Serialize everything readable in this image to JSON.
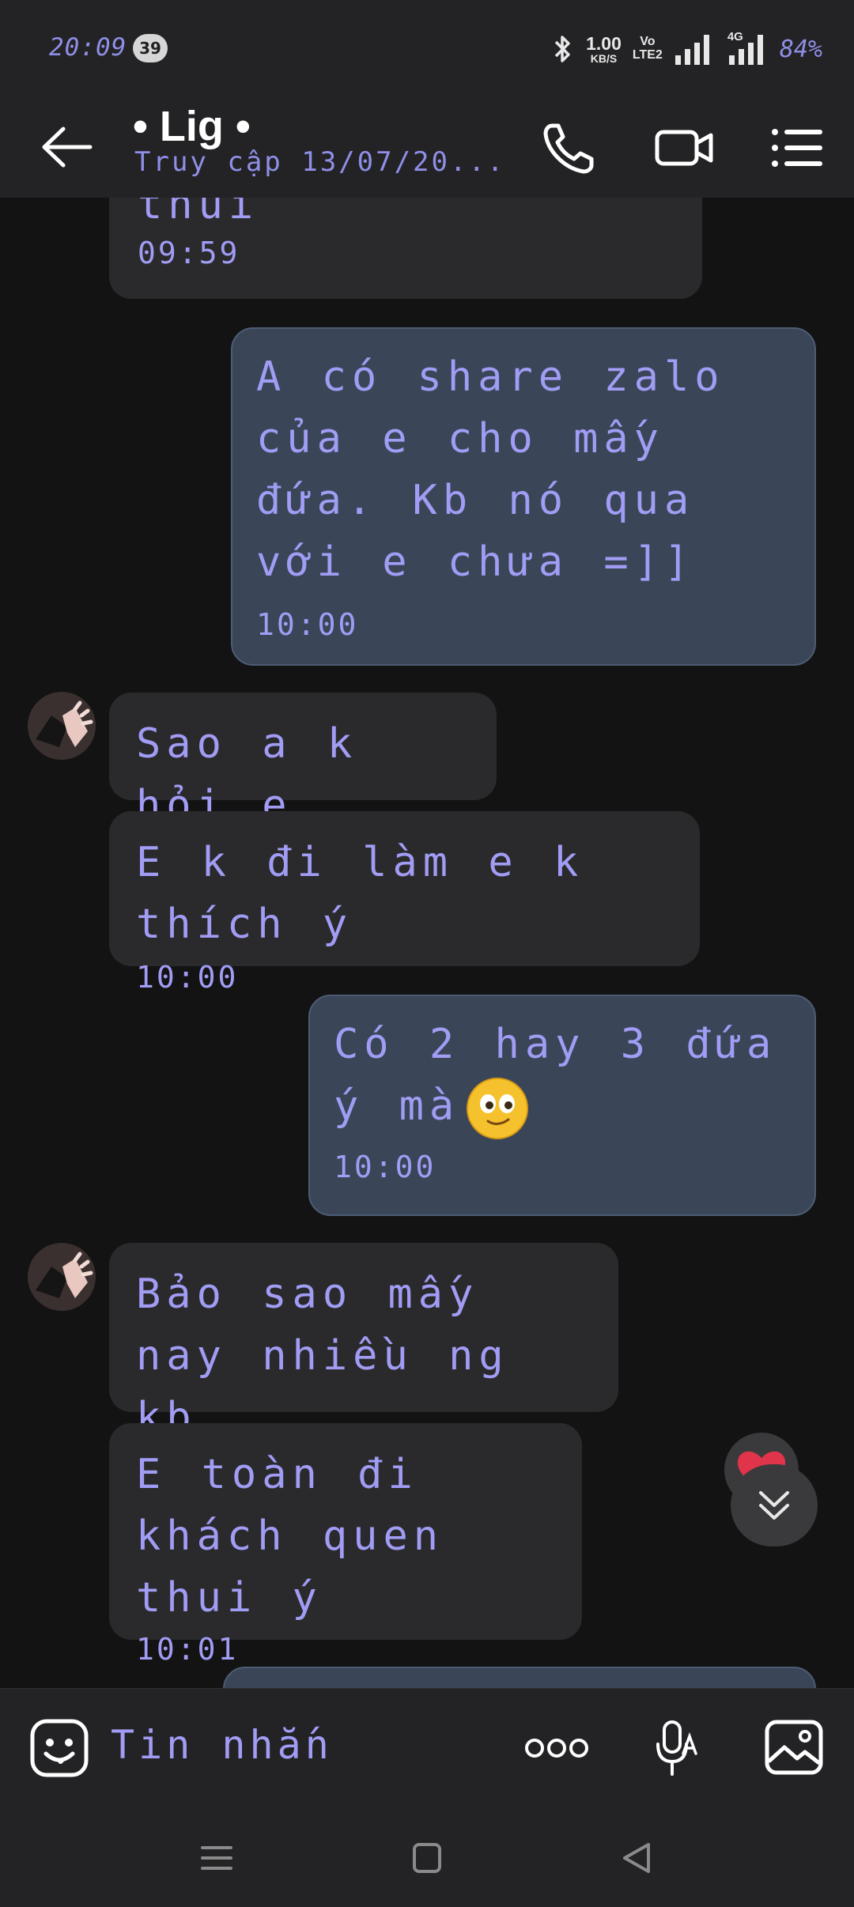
{
  "status_bar": {
    "time": "20:09",
    "notification_count": "39",
    "net_speed_value": "1.00",
    "net_speed_unit": "KB/S",
    "volte_line1": "Vo",
    "volte_line2": "LTE2",
    "network_type": "4G",
    "battery": "84%"
  },
  "header": {
    "title": "• Lig •",
    "subtitle": "Truy cập 13/07/20..."
  },
  "messages": [
    {
      "sender": "contact",
      "text": "thui",
      "time": "09:59"
    },
    {
      "sender": "me",
      "text": "A có share zalo của e cho mấy đứa. Kb nó qua với e chưa =]]",
      "time": "10:00"
    },
    {
      "sender": "contact",
      "text": "Sao a k hỏi e",
      "time": ""
    },
    {
      "sender": "contact",
      "text": "E k đi làm e k thích ý",
      "time": "10:00"
    },
    {
      "sender": "me",
      "text": "Có 2 hay 3 đứa ý mà",
      "emoji": "smiling-face-emoji",
      "time": "10:00"
    },
    {
      "sender": "contact",
      "text": "Bảo sao mấy nay nhiều ng kb",
      "time": ""
    },
    {
      "sender": "contact",
      "text": "E toàn đi khách quen thui ý",
      "time": "10:01",
      "reaction": "heart"
    }
  ],
  "input": {
    "placeholder": "Tin nhắn"
  },
  "colors": {
    "bar_bg": "#232325",
    "chat_bg": "#131313",
    "incoming_bubble": "#2a2a2c",
    "outgoing_bubble": "#3a4658",
    "message_text": "#a19cf4",
    "reaction_heart": "#e0344a"
  },
  "icons": [
    "back-arrow-icon",
    "phone-icon",
    "video-call-icon",
    "menu-list-icon",
    "sticker-icon",
    "more-dots-icon",
    "voice-mic-icon",
    "image-gallery-icon",
    "chevron-double-down-icon",
    "heart-icon"
  ]
}
